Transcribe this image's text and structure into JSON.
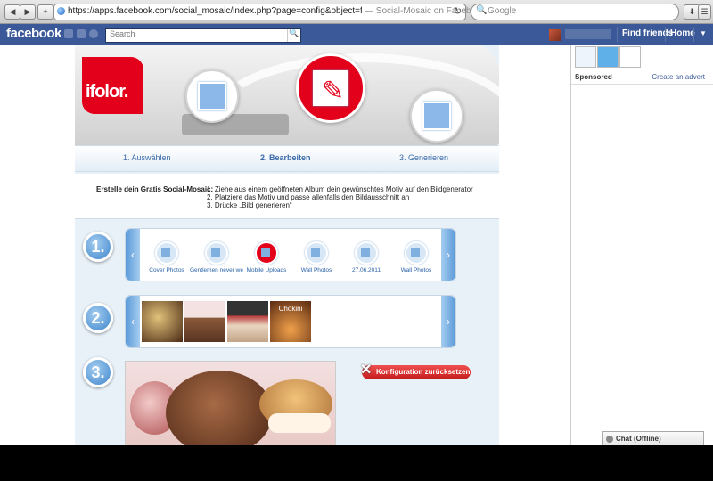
{
  "browser": {
    "back_icon": "◀",
    "forward_icon": "▶",
    "add_icon": "+",
    "url": "https://apps.facebook.com/social_mosaic/index.php?page=config&object=freemosaic...",
    "page_title": "— Social-Mosaic on Facebook",
    "reload_icon": "↻",
    "search_placeholder": "Google",
    "search_icon": "🔍",
    "download_icon": "⬇",
    "menu_icon": "☰"
  },
  "facebook": {
    "logo": "facebook",
    "search_placeholder": "Search",
    "search_icon": "🔍",
    "find_friends": "Find friends",
    "home": "Home",
    "dropdown_icon": "▼"
  },
  "app": {
    "logo": "ifolor.",
    "steps": [
      "1. Auswählen",
      "2. Bearbeiten",
      "3. Generieren"
    ],
    "instructions_label": "Erstelle dein Gratis Social-Mosaic:",
    "instructions": [
      "1.  Ziehe aus einem geöffneten Album dein gewünschtes Motiv auf den Bildgenerator",
      "2.  Platziere das Motiv und passe allenfalls den Bildausschnitt an",
      "3.  Drücke „Bild generieren“"
    ],
    "step_numbers": [
      "1.",
      "2.",
      "3."
    ],
    "albums": [
      "Cover Photos",
      "Gentlemen never we",
      "Mobile Uploads",
      "Wall Photos",
      "27.06.2011",
      "Wall Photos"
    ],
    "scroll_left_icon": "‹",
    "scroll_right_icon": "›",
    "reset_label": "Konfiguration zurücksetzen",
    "reset_icon": "✕",
    "photos": [
      "photo-1",
      "photo-2",
      "photo-3",
      "photo-4"
    ],
    "thumb_texts": [
      "Chokini"
    ]
  },
  "sidebar": {
    "sponsored": "Sponsored",
    "create_advert": "Create an advert",
    "chat": "Chat (Offline)"
  }
}
